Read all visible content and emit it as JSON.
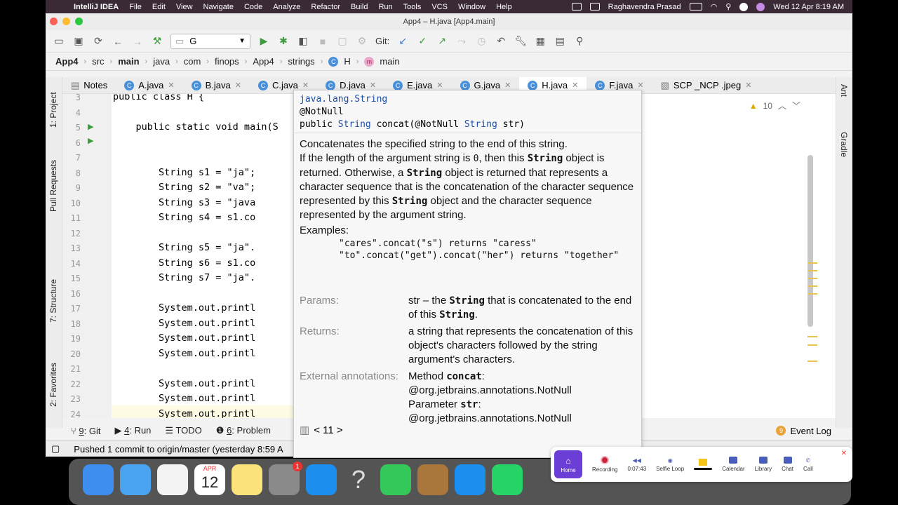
{
  "menubar": {
    "app": "IntelliJ IDEA",
    "items": [
      "File",
      "Edit",
      "View",
      "Navigate",
      "Code",
      "Analyze",
      "Refactor",
      "Build",
      "Run",
      "Tools",
      "VCS",
      "Window",
      "Help"
    ],
    "user": "Raghavendra Prasad",
    "datetime": "Wed 12 Apr  8:19 AM"
  },
  "window": {
    "title": "App4 – H.java [App4.main]"
  },
  "toolbar": {
    "run_config": "G",
    "git_label": "Git:"
  },
  "breadcrumb": [
    "App4",
    "src",
    "main",
    "java",
    "com",
    "finops",
    "App4",
    "strings",
    "H",
    "main"
  ],
  "tabs": [
    "Notes",
    "A.java",
    "B.java",
    "C.java",
    "D.java",
    "E.java",
    "G.java",
    "H.java",
    "F.java",
    "SCP _NCP .jpeg"
  ],
  "left_tools": [
    "1: Project",
    "Pull Requests",
    "7: Structure",
    "2: Favorites"
  ],
  "right_tools": [
    "Ant",
    "Gradle"
  ],
  "editor": {
    "warnings": "10",
    "lines": [
      {
        "n": "3",
        "text": "public class H {"
      },
      {
        "n": "4",
        "text": ""
      },
      {
        "n": "5",
        "text": "    public static void main(S"
      },
      {
        "n": "6",
        "text": ""
      },
      {
        "n": "7",
        "text": ""
      },
      {
        "n": "8",
        "text": "        String s1 = \"ja\";"
      },
      {
        "n": "9",
        "text": "        String s2 = \"va\";"
      },
      {
        "n": "10",
        "text": "        String s3 = \"java"
      },
      {
        "n": "11",
        "text": "        String s4 = s1.co"
      },
      {
        "n": "12",
        "text": ""
      },
      {
        "n": "13",
        "text": "        String s5 = \"ja\"."
      },
      {
        "n": "14",
        "text": "        String s6 = s1.co"
      },
      {
        "n": "15",
        "text": "        String s7 = \"ja\"."
      },
      {
        "n": "16",
        "text": ""
      },
      {
        "n": "17",
        "text": "        System.out.printl"
      },
      {
        "n": "18",
        "text": "        System.out.printl"
      },
      {
        "n": "19",
        "text": "        System.out.printl"
      },
      {
        "n": "20",
        "text": "        System.out.printl"
      },
      {
        "n": "21",
        "text": ""
      },
      {
        "n": "22",
        "text": "        System.out.printl"
      },
      {
        "n": "23",
        "text": "        System.out.printl"
      },
      {
        "n": "24",
        "text": "        System.out.printl"
      }
    ]
  },
  "doc": {
    "package": "java.lang.String",
    "annotation": "@NotNull",
    "signature_prefix": "public ",
    "signature_type": "String",
    "signature_method": " concat(@NotNull ",
    "signature_param_type": "String",
    "signature_param": " str)",
    "desc1": "Concatenates the specified string to the end of this string.",
    "desc2a": "If the length of the argument string is ",
    "desc2_zero": "0",
    "desc2b": ", then this ",
    "desc2_string": "String",
    "desc2c": " object is returned. Otherwise, a ",
    "desc2d": " object is returned that represents a character sequence that is the concatenation of the character sequence represented by this ",
    "desc2e": " object and the character sequence represented by the argument string.",
    "examples_label": "Examples:",
    "example1": "\"cares\".concat(\"s\") returns \"caress\"",
    "example2": "\"to\".concat(\"get\").concat(\"her\") returns \"together\"",
    "params_label": "Params:",
    "params_a": "str – the ",
    "params_b": " that is concatenated to the end of this ",
    "params_c": ".",
    "returns_label": "Returns:",
    "returns_text": "a string that represents the concatenation of this object's characters followed by the string argument's characters.",
    "ext_label": "External annotations:",
    "ext_method": "Method ",
    "ext_concat": "concat",
    "ext_method_rest": ": @org.jetbrains.annotations.NotNull",
    "ext_param": "Parameter ",
    "ext_str": "str",
    "ext_param_rest": ": @org.jetbrains.annotations.NotNull",
    "pager": "< 11 >"
  },
  "bottom_tools": [
    {
      "num": "9",
      "label": ": Git"
    },
    {
      "num": "4",
      "label": ": Run"
    },
    {
      "num": "",
      "label": "TODO"
    },
    {
      "num": "6",
      "label": ": Problem"
    }
  ],
  "event_log": {
    "count": "9",
    "label": "Event Log"
  },
  "status": {
    "text": "Pushed 1 commit to origin/master (yesterday 8:59 A"
  },
  "recording_bar": {
    "items": [
      "Home",
      "Recording",
      "0:07:43",
      "Selfie Loop",
      "Calendar",
      "Library",
      "Chat",
      "Call"
    ]
  },
  "dock": {
    "calendar_month": "APR",
    "calendar_day": "12",
    "settings_badge": "1"
  }
}
